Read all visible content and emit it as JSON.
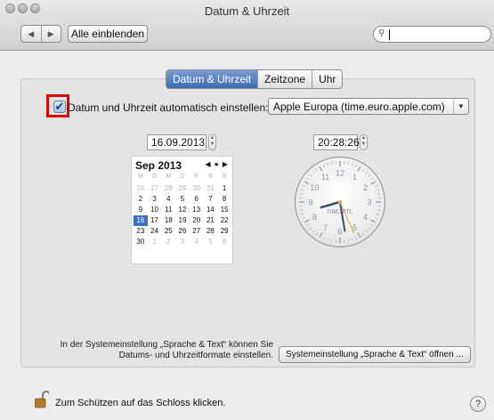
{
  "window": {
    "title": "Datum & Uhrzeit"
  },
  "toolbar": {
    "back": "◀",
    "forward": "▶",
    "show_all": "Alle einblenden",
    "search_icon": "search-icon",
    "search_value": ""
  },
  "tabs": [
    "Datum & Uhrzeit",
    "Zeitzone",
    "Uhr"
  ],
  "selected_tab": 0,
  "auto": {
    "checked": true,
    "label": "Datum und Uhrzeit automatisch einstellen:",
    "server": "Apple Europa (time.euro.apple.com)"
  },
  "date_value": "16.09.2013",
  "time_value": "20:28:26",
  "calendar": {
    "month": "Sep 2013",
    "nav": "◀ ● ▶",
    "weekdays": [
      "M",
      "D",
      "M",
      "D",
      "F",
      "S",
      "S"
    ],
    "days": [
      [
        "26",
        "27",
        "28",
        "29",
        "30",
        "31",
        "1"
      ],
      [
        "2",
        "3",
        "4",
        "5",
        "6",
        "7",
        "8"
      ],
      [
        "9",
        "10",
        "11",
        "12",
        "13",
        "14",
        "15"
      ],
      [
        "16",
        "17",
        "18",
        "19",
        "20",
        "21",
        "22"
      ],
      [
        "23",
        "24",
        "25",
        "26",
        "27",
        "28",
        "29"
      ],
      [
        "30",
        "1",
        "2",
        "3",
        "4",
        "5",
        "6"
      ]
    ],
    "selected": "16"
  },
  "clock": {
    "numbers": [
      "12",
      "1",
      "2",
      "3",
      "4",
      "5",
      "6",
      "7",
      "8",
      "9",
      "10",
      "11"
    ],
    "ampm": "nachm.",
    "hour": 20,
    "minute": 28,
    "second": 26
  },
  "info_text": "In der Systemeinstellung „Sprache & Text“ können Sie Datums- und Uhrzeitformate einstellen.",
  "info_button": "Systemeinstellung „Sprache & Text“ öffnen ...",
  "lock_text": "Zum Schützen auf das Schloss klicken.",
  "help": "?"
}
